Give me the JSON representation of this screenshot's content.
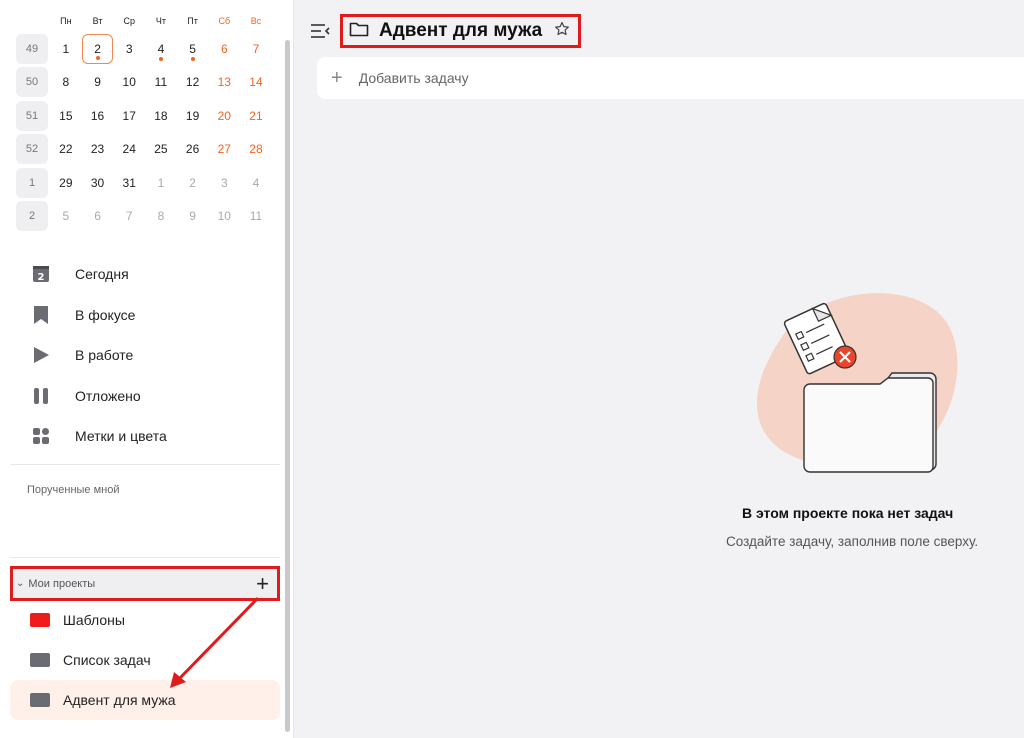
{
  "calendar": {
    "weekdays": [
      "Пн",
      "Вт",
      "Ср",
      "Чт",
      "Пт",
      "Сб",
      "Вс"
    ],
    "weeks": [
      {
        "num": "49",
        "days": [
          "1",
          "2",
          "3",
          "4",
          "5",
          "6",
          "7"
        ]
      },
      {
        "num": "50",
        "days": [
          "8",
          "9",
          "10",
          "11",
          "12",
          "13",
          "14"
        ]
      },
      {
        "num": "51",
        "days": [
          "15",
          "16",
          "17",
          "18",
          "19",
          "20",
          "21"
        ]
      },
      {
        "num": "52",
        "days": [
          "22",
          "23",
          "24",
          "25",
          "26",
          "27",
          "28"
        ]
      },
      {
        "num": "1",
        "days": [
          "29",
          "30",
          "31",
          "1",
          "2",
          "3",
          "4"
        ]
      },
      {
        "num": "2",
        "days": [
          "5",
          "6",
          "7",
          "8",
          "9",
          "10",
          "11"
        ]
      }
    ]
  },
  "nav": {
    "today_badge": "2",
    "items": [
      {
        "label": "Сегодня",
        "icon": "calendar-today-icon"
      },
      {
        "label": "В фокусе",
        "icon": "bookmark-icon"
      },
      {
        "label": "В работе",
        "icon": "play-icon"
      },
      {
        "label": "Отложено",
        "icon": "pause-icon"
      },
      {
        "label": "Метки и цвета",
        "icon": "tags-icon"
      }
    ]
  },
  "assigned": {
    "label": "Порученные мной"
  },
  "projects": {
    "header": "Мои проекты",
    "items": [
      {
        "label": "Шаблоны",
        "color": "#ee1c1c"
      },
      {
        "label": "Список задач",
        "color": "#6b6b73"
      },
      {
        "label": "Адвент для мужа",
        "color": "#6b6b73"
      }
    ]
  },
  "main": {
    "title": "Адвент для мужа",
    "add_task": "Добавить задачу",
    "empty_title": "В этом проекте пока нет задач",
    "empty_sub": "Создайте задачу, заполнив поле сверху."
  },
  "colors": {
    "accent": "#f26522",
    "highlight": "#e01b1b",
    "blob": "#f5d3c6"
  }
}
